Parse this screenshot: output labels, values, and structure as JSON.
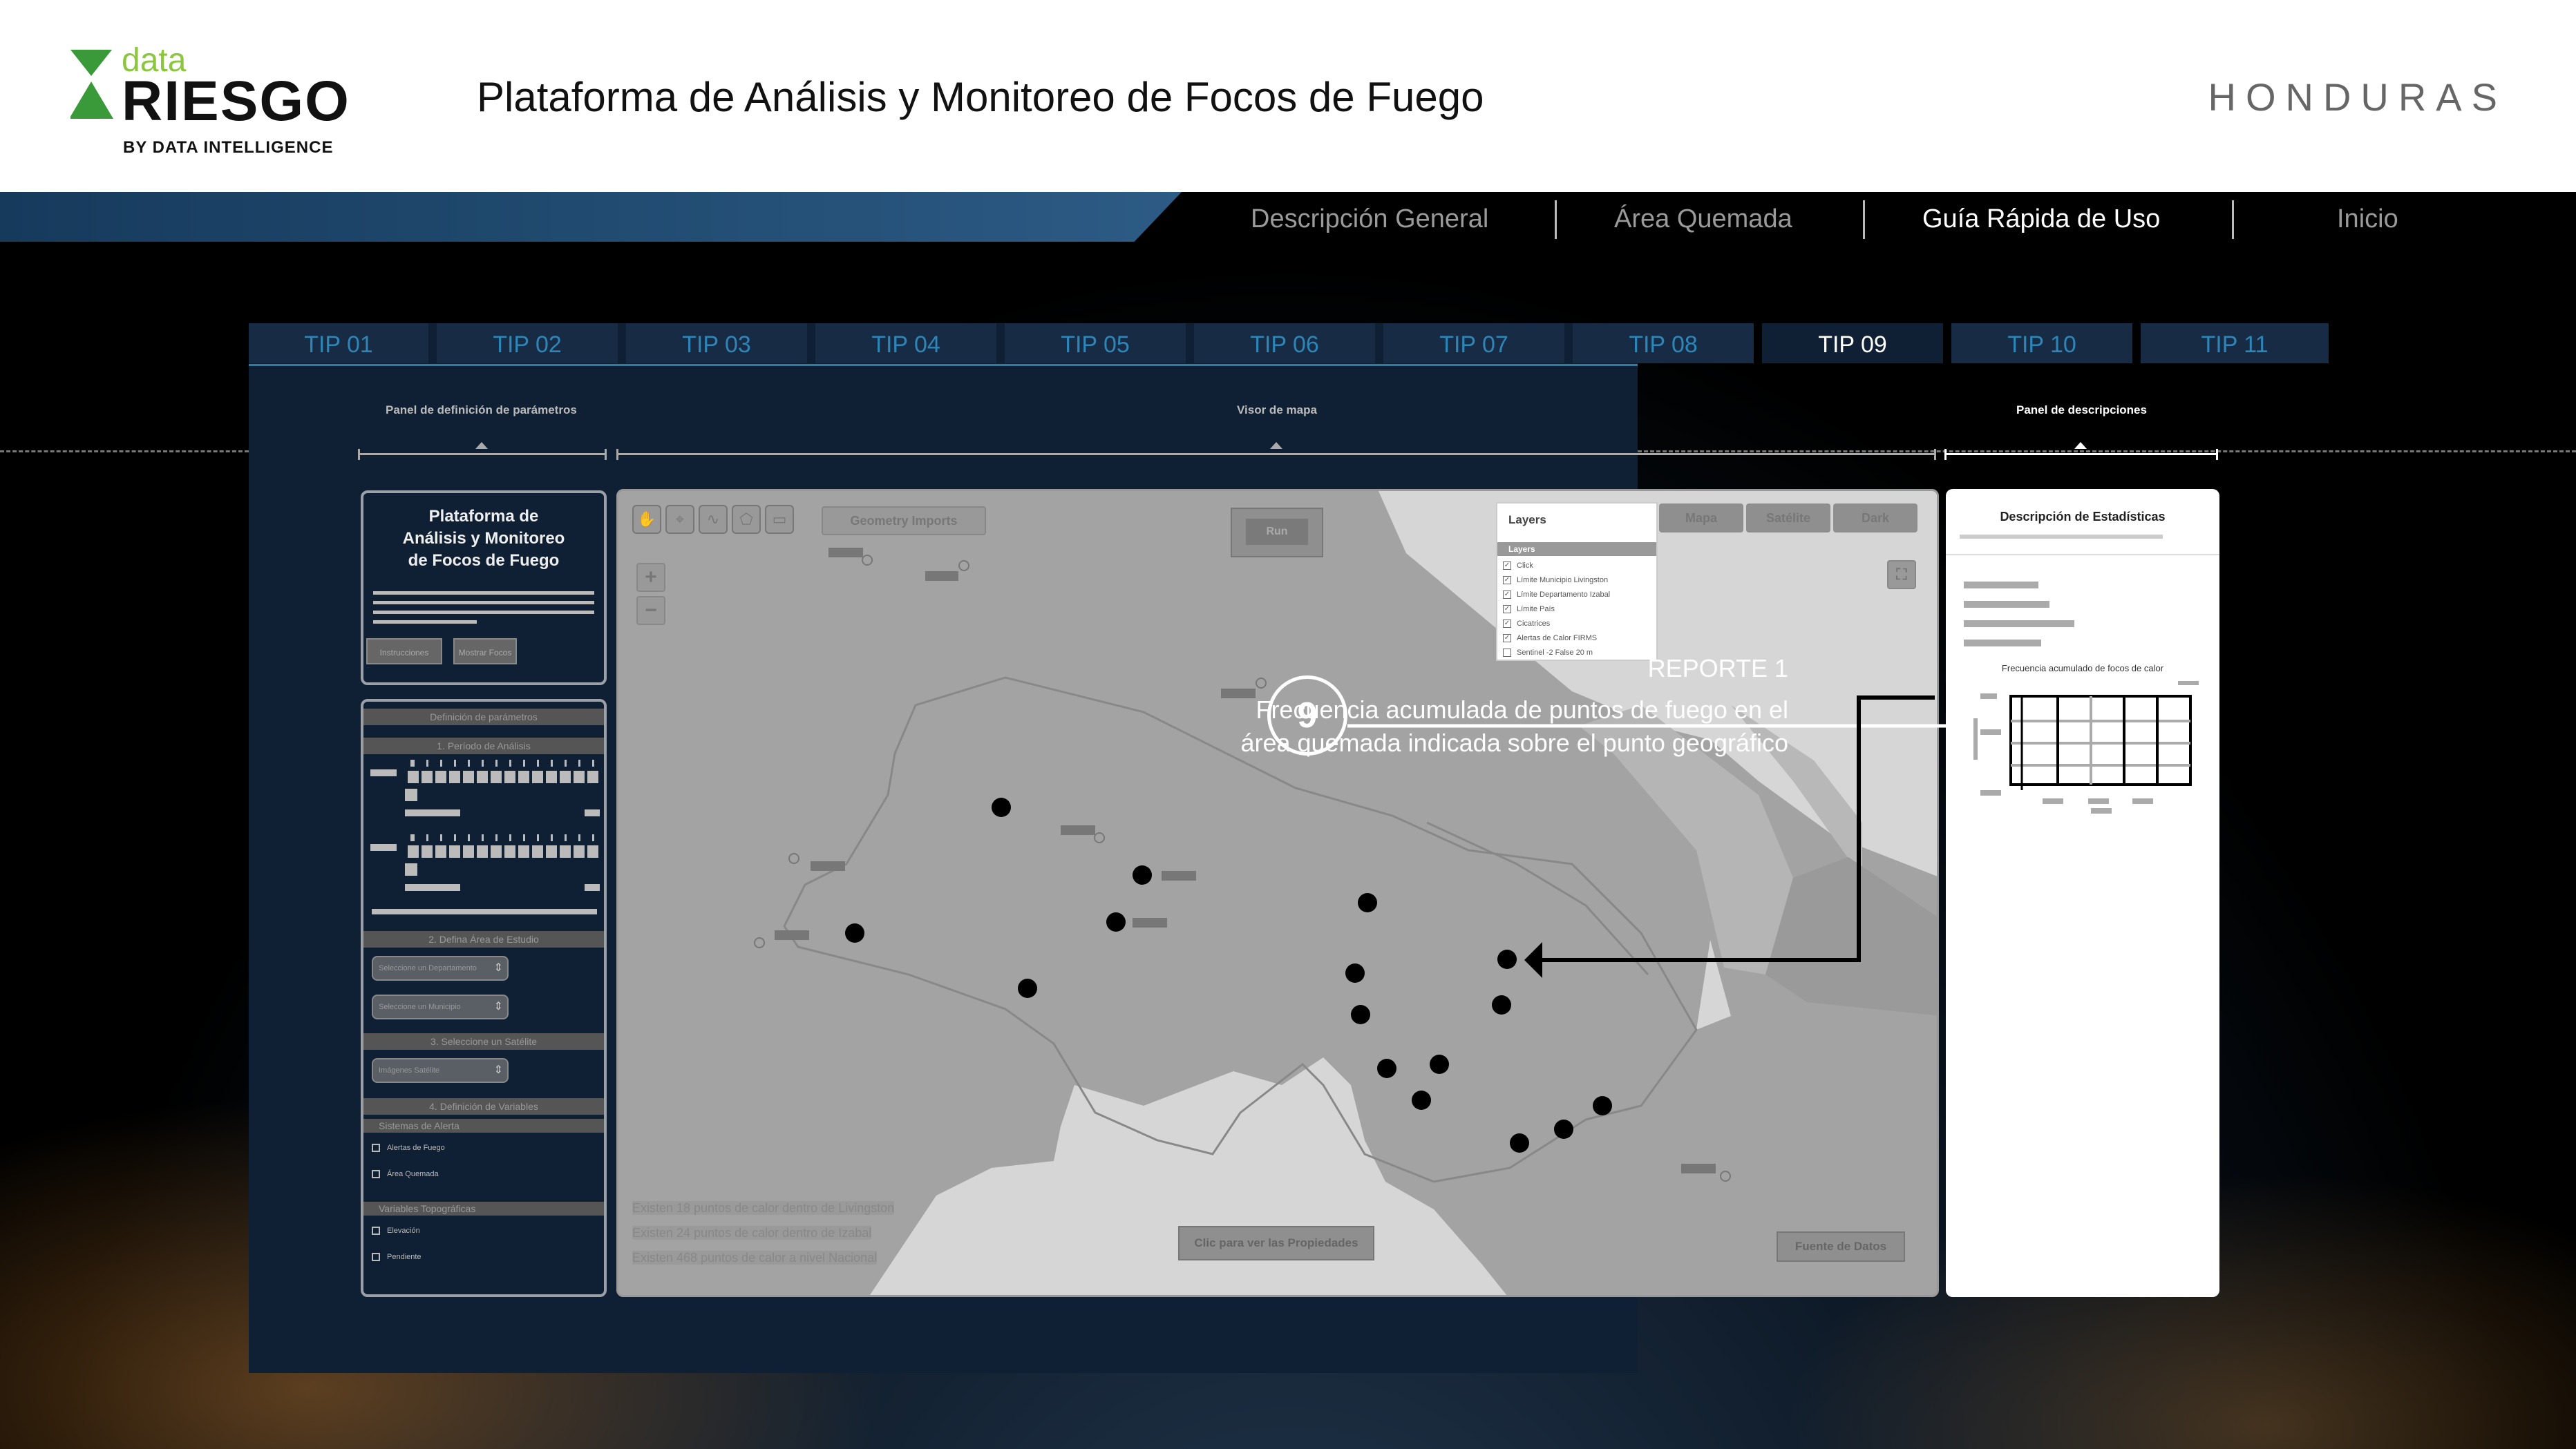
{
  "header": {
    "logo_data": "data",
    "logo_riesgo": "RIESGO",
    "logo_byline": "BY DATA INTELLIGENCE",
    "title": "Plataforma de Análisis y Monitoreo de Focos de Fuego",
    "country": "HONDURAS"
  },
  "nav": {
    "items": [
      "Descripción General",
      "Área Quemada",
      "Guía Rápida de Uso",
      "Inicio"
    ],
    "active": "Guía Rápida de Uso"
  },
  "tips": [
    "TIP 01",
    "TIP 02",
    "TIP 03",
    "TIP 04",
    "TIP 05",
    "TIP 06",
    "TIP 07",
    "TIP 08",
    "TIP 09",
    "TIP 10",
    "TIP 11"
  ],
  "active_tip": "TIP 09",
  "sections": {
    "left": "Panel de definición de parámetros",
    "center": "Visor de mapa",
    "right": "Panel de descripciones"
  },
  "left_panel": {
    "title": "Plataforma de Análisis y Monitoreo de Focos de Fuego",
    "btn_instructions": "Instrucciones",
    "btn_show": "Mostrar Focos",
    "params_title": "Definición de parámetros",
    "step1": "1. Período de Análisis",
    "step2": "2. Defina Área de Estudio",
    "select_department": "Seleccione un Departamento",
    "select_municipality": "Seleccione un Municipio",
    "step3": "3. Seleccione un Satélite",
    "select_satellite": "Imágenes Satélite",
    "step4": "4. Definición de Variables",
    "alert_system": "Sistemas de Alerta",
    "check_fire": "Alertas de Fuego",
    "check_burned": "Área Quemada",
    "topo_vars": "Variables Topográficas",
    "check_elevation": "Elevación",
    "check_slope": "Pendiente"
  },
  "map": {
    "geometry_imports": "Geometry Imports",
    "run": "Run",
    "tabs": [
      "Mapa",
      "Satélite",
      "Dark"
    ],
    "layers_title": "Layers",
    "layers_head": "Layers",
    "layers": [
      {
        "label": "Click",
        "checked": true
      },
      {
        "label": "Límite Municipio Livingston",
        "checked": true
      },
      {
        "label": "Límite Departamento Izabal",
        "checked": true
      },
      {
        "label": "Límite País",
        "checked": true
      },
      {
        "label": "Cicatrices",
        "checked": true
      },
      {
        "label": "Alertas de Calor FIRMS",
        "checked": true
      },
      {
        "label": "Sentinel -2 False 20 m",
        "checked": false
      }
    ],
    "info_lines": [
      "Existen 18 puntos de calor dentro de Livingston",
      "Existen 24 puntos de calor dentro de Izabal",
      "Existen 468 puntos de calor a nivel Nacional"
    ],
    "props_button": "Clic para ver las Propiedades",
    "data_source": "Fuente de Datos",
    "zoom_in": "+",
    "zoom_out": "−"
  },
  "callout": {
    "title": "REPORTE 1",
    "line1": "Frecuencia acumulada de puntos de fuego en el",
    "line2": "área quemada indicada sobre el punto geográfico",
    "number": "9"
  },
  "right_panel": {
    "title": "Descripción de Estadísticas",
    "chart_title": "Frecuencia acumulado de focos de calor"
  }
}
